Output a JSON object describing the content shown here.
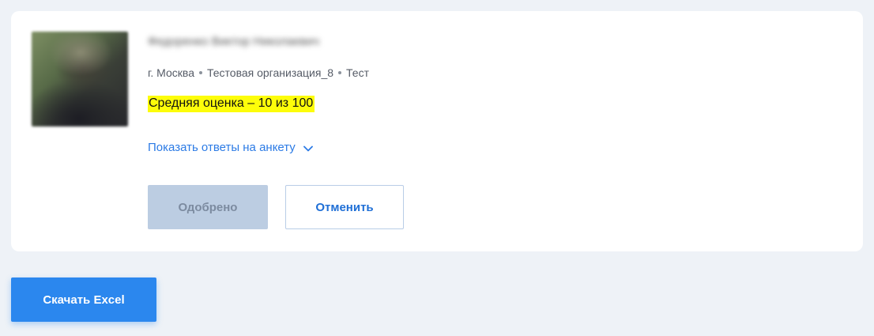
{
  "profile": {
    "name": "Федоренко Виктор Николаевич",
    "city": "г. Москва",
    "organization": "Тестовая организация_8",
    "role": "Тест",
    "score_text": "Средняя оценка – 10 из 100"
  },
  "answers_toggle": {
    "label": "Показать ответы на анкету",
    "icon": "chevron-down-icon"
  },
  "actions": {
    "approved_label": "Одобрено",
    "cancel_label": "Отменить"
  },
  "download": {
    "label": "Скачать Excel"
  },
  "colors": {
    "accent": "#2b87ee",
    "link": "#2c7be5",
    "highlight": "#fdfd0a",
    "disabled_button": "#bccde2",
    "page_background": "#eef2f7"
  }
}
